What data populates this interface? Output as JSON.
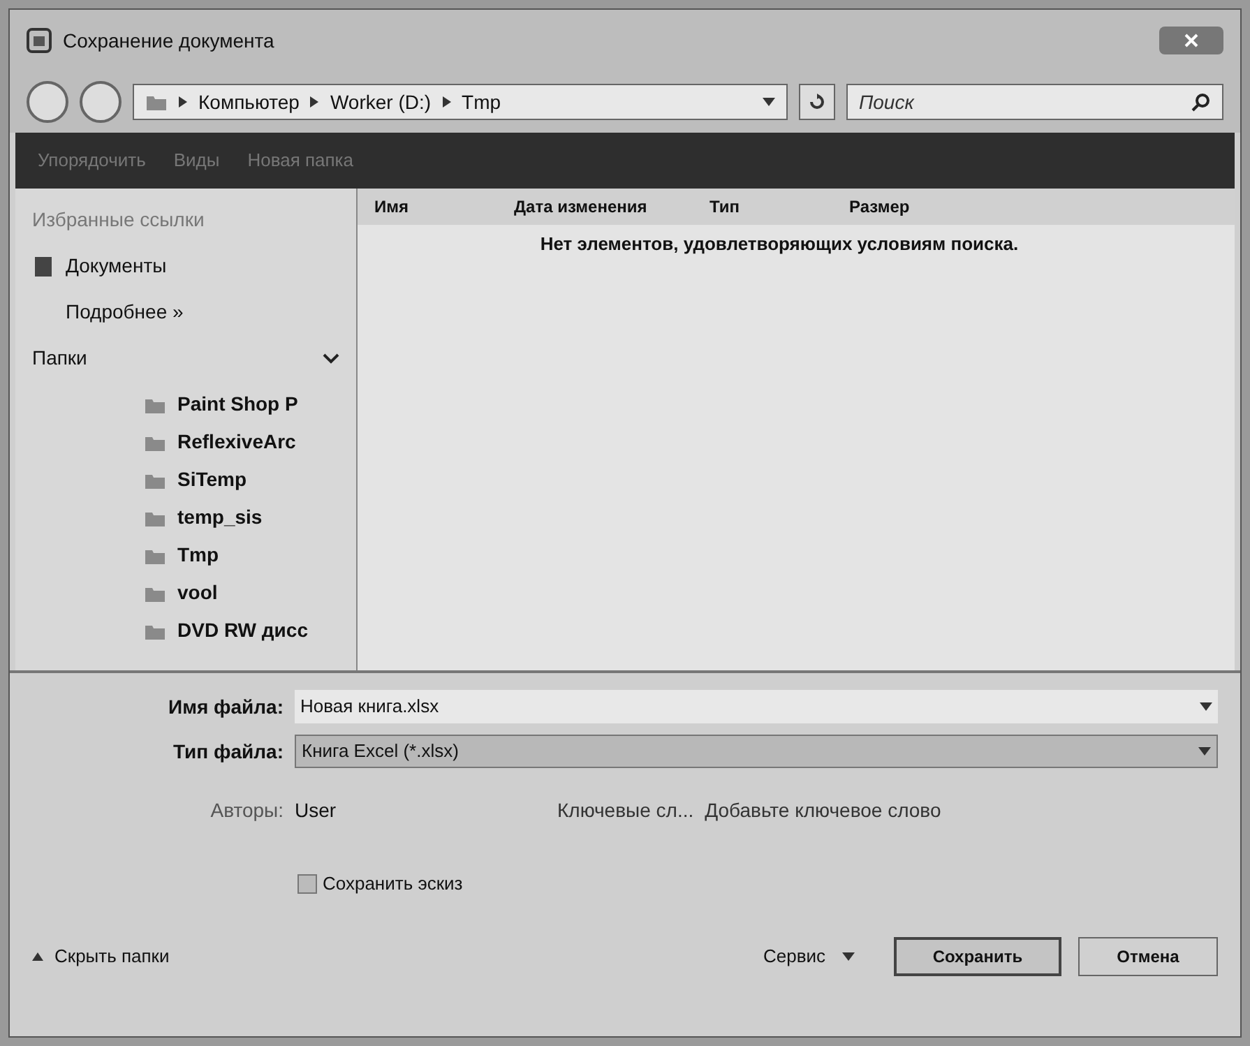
{
  "window": {
    "title": "Сохранение документа"
  },
  "address": {
    "crumbs": [
      "Компьютер",
      "Worker (D:)",
      "Tmp"
    ]
  },
  "search": {
    "placeholder": "Поиск"
  },
  "toolbar": [
    "Упорядочить",
    "Виды",
    "Новая папка"
  ],
  "favorites": {
    "title": "Избранные ссылки",
    "items": [
      "Документы"
    ],
    "more": "Подробнее »"
  },
  "folders": {
    "title": "Папки",
    "items": [
      {
        "name": "Paint Shop P"
      },
      {
        "name": "ReflexiveArc"
      },
      {
        "name": "SiTemp"
      },
      {
        "name": "temp_sis"
      },
      {
        "name": "Tmp"
      },
      {
        "name": "vool"
      },
      {
        "name": "DVD RW дисс"
      }
    ]
  },
  "table": {
    "columns": [
      "Имя",
      "Дата изменения",
      "Тип",
      "Размер"
    ],
    "empty": "Нет элементов, удовлетворяющих условиям поиска."
  },
  "form": {
    "filename_label": "Имя файла:",
    "filename": "Новая книга.xlsx",
    "type_label": "Тип файла:",
    "type": "Книга Excel (*.xlsx)",
    "authors_label": "Авторы:",
    "authors": "User",
    "keywords_label": "Ключевые сл...",
    "keywords": "Добавьте ключевое слово",
    "thumbnail": {
      "label": "Сохранить эскиз",
      "checked": false
    }
  },
  "footer": {
    "hide": "Скрыть папки",
    "service": "Сервис",
    "save": "Сохранить",
    "cancel": "Отмена"
  }
}
